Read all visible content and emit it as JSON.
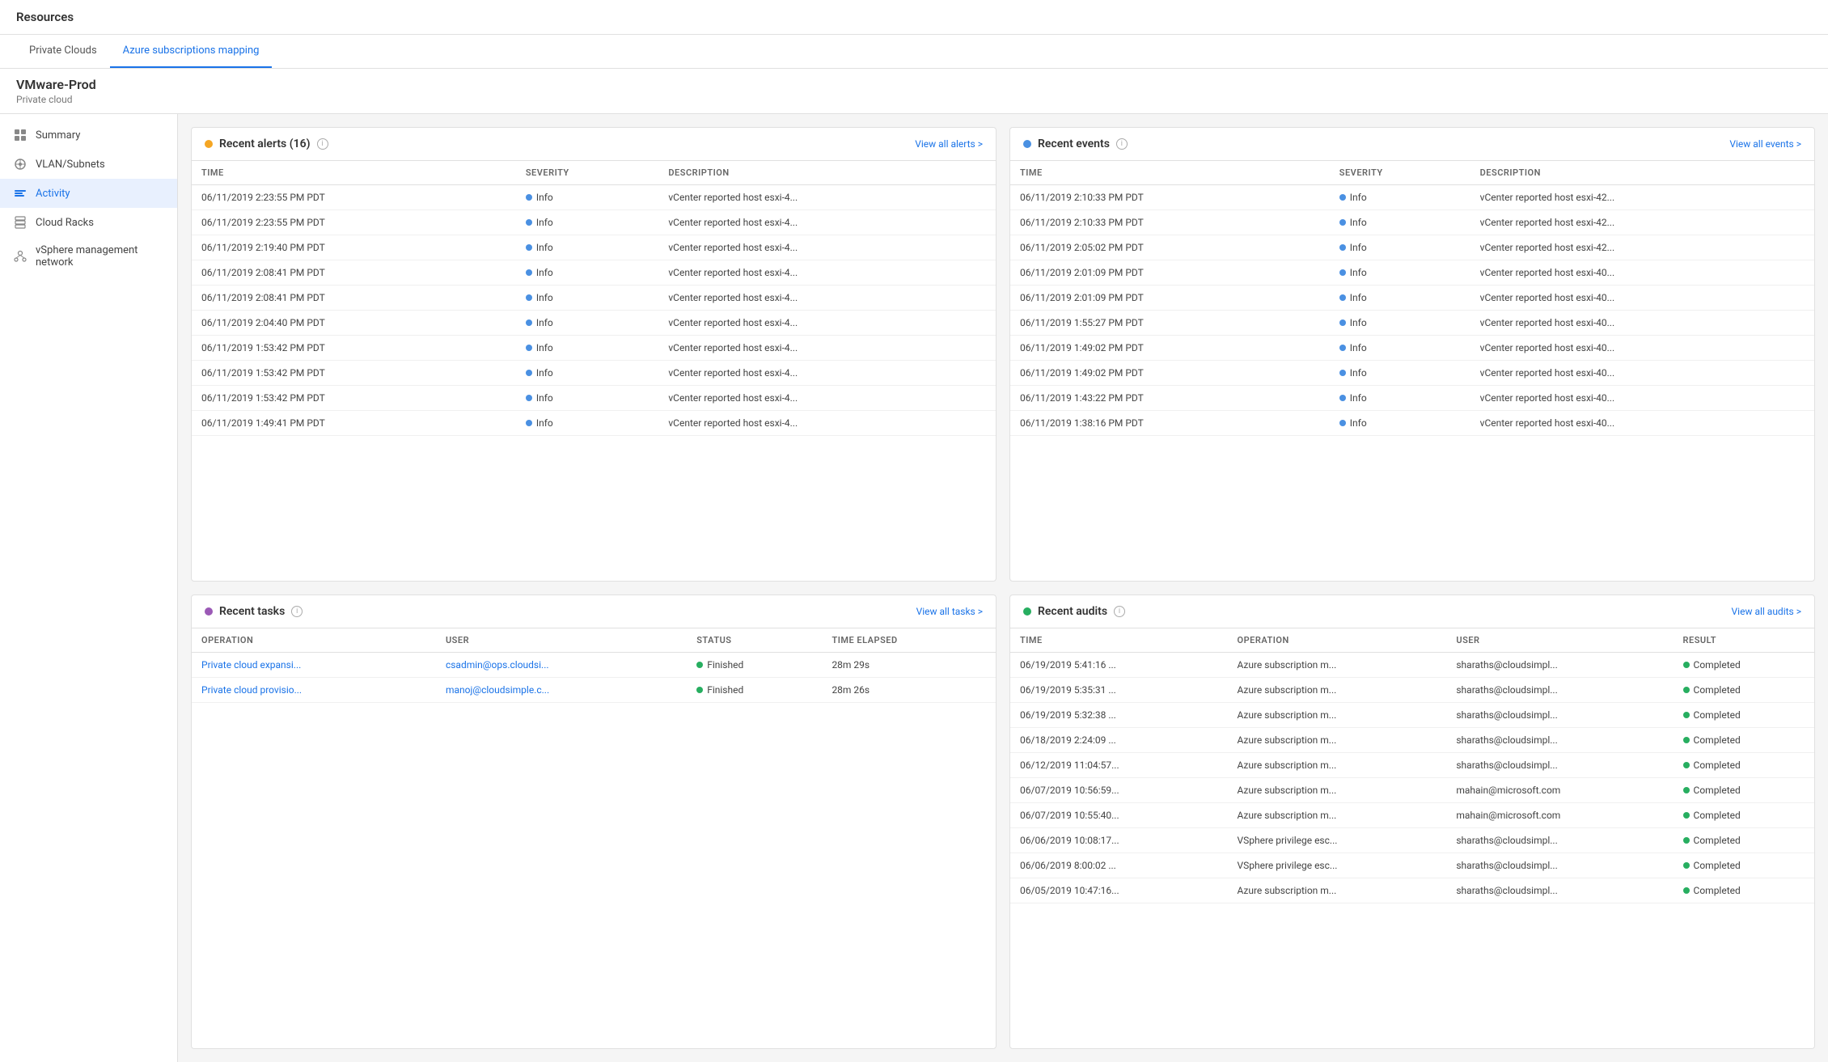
{
  "topBar": {
    "title": "Resources"
  },
  "tabs": [
    {
      "label": "Private Clouds",
      "active": false
    },
    {
      "label": "Azure subscriptions mapping",
      "active": false
    }
  ],
  "vmHeader": {
    "name": "VMware-Prod",
    "subtitle": "Private cloud"
  },
  "sidebar": {
    "items": [
      {
        "label": "Summary",
        "icon": "grid",
        "active": false
      },
      {
        "label": "VLAN/Subnets",
        "icon": "subnet",
        "active": false
      },
      {
        "label": "Activity",
        "icon": "activity",
        "active": true
      },
      {
        "label": "Cloud Racks",
        "icon": "rack",
        "active": false
      },
      {
        "label": "vSphere management network",
        "icon": "network",
        "active": false
      }
    ]
  },
  "alerts": {
    "title": "Recent alerts",
    "count": "16",
    "viewAllLabel": "View all alerts >",
    "columns": [
      "TIME",
      "SEVERITY",
      "DESCRIPTION"
    ],
    "rows": [
      {
        "time": "06/11/2019 2:23:55 PM PDT",
        "severity": "Info",
        "description": "vCenter reported host esxi-4..."
      },
      {
        "time": "06/11/2019 2:23:55 PM PDT",
        "severity": "Info",
        "description": "vCenter reported host esxi-4..."
      },
      {
        "time": "06/11/2019 2:19:40 PM PDT",
        "severity": "Info",
        "description": "vCenter reported host esxi-4..."
      },
      {
        "time": "06/11/2019 2:08:41 PM PDT",
        "severity": "Info",
        "description": "vCenter reported host esxi-4..."
      },
      {
        "time": "06/11/2019 2:08:41 PM PDT",
        "severity": "Info",
        "description": "vCenter reported host esxi-4..."
      },
      {
        "time": "06/11/2019 2:04:40 PM PDT",
        "severity": "Info",
        "description": "vCenter reported host esxi-4..."
      },
      {
        "time": "06/11/2019 1:53:42 PM PDT",
        "severity": "Info",
        "description": "vCenter reported host esxi-4..."
      },
      {
        "time": "06/11/2019 1:53:42 PM PDT",
        "severity": "Info",
        "description": "vCenter reported host esxi-4..."
      },
      {
        "time": "06/11/2019 1:53:42 PM PDT",
        "severity": "Info",
        "description": "vCenter reported host esxi-4..."
      },
      {
        "time": "06/11/2019 1:49:41 PM PDT",
        "severity": "Info",
        "description": "vCenter reported host esxi-4..."
      }
    ]
  },
  "events": {
    "title": "Recent events",
    "viewAllLabel": "View all events >",
    "columns": [
      "TIME",
      "SEVERITY",
      "DESCRIPTION"
    ],
    "rows": [
      {
        "time": "06/11/2019 2:10:33 PM PDT",
        "severity": "Info",
        "description": "vCenter reported host esxi-42..."
      },
      {
        "time": "06/11/2019 2:10:33 PM PDT",
        "severity": "Info",
        "description": "vCenter reported host esxi-42..."
      },
      {
        "time": "06/11/2019 2:05:02 PM PDT",
        "severity": "Info",
        "description": "vCenter reported host esxi-42..."
      },
      {
        "time": "06/11/2019 2:01:09 PM PDT",
        "severity": "Info",
        "description": "vCenter reported host esxi-40..."
      },
      {
        "time": "06/11/2019 2:01:09 PM PDT",
        "severity": "Info",
        "description": "vCenter reported host esxi-40..."
      },
      {
        "time": "06/11/2019 1:55:27 PM PDT",
        "severity": "Info",
        "description": "vCenter reported host esxi-40..."
      },
      {
        "time": "06/11/2019 1:49:02 PM PDT",
        "severity": "Info",
        "description": "vCenter reported host esxi-40..."
      },
      {
        "time": "06/11/2019 1:49:02 PM PDT",
        "severity": "Info",
        "description": "vCenter reported host esxi-40..."
      },
      {
        "time": "06/11/2019 1:43:22 PM PDT",
        "severity": "Info",
        "description": "vCenter reported host esxi-40..."
      },
      {
        "time": "06/11/2019 1:38:16 PM PDT",
        "severity": "Info",
        "description": "vCenter reported host esxi-40..."
      }
    ]
  },
  "tasks": {
    "title": "Recent tasks",
    "viewAllLabel": "View all tasks >",
    "columns": [
      "OPERATION",
      "USER",
      "STATUS",
      "TIME ELAPSED"
    ],
    "rows": [
      {
        "operation": "Private cloud expansi...",
        "user": "csadmin@ops.cloudsi...",
        "status": "Finished",
        "timeElapsed": "28m 29s"
      },
      {
        "operation": "Private cloud provisio...",
        "user": "manoj@cloudsimple.c...",
        "status": "Finished",
        "timeElapsed": "28m 26s"
      }
    ]
  },
  "audits": {
    "title": "Recent audits",
    "viewAllLabel": "View all audits >",
    "columns": [
      "TIME",
      "OPERATION",
      "USER",
      "RESULT"
    ],
    "rows": [
      {
        "time": "06/19/2019 5:41:16 ...",
        "operation": "Azure subscription m...",
        "user": "sharaths@cloudsimpl...",
        "result": "Completed"
      },
      {
        "time": "06/19/2019 5:35:31 ...",
        "operation": "Azure subscription m...",
        "user": "sharaths@cloudsimpl...",
        "result": "Completed"
      },
      {
        "time": "06/19/2019 5:32:38 ...",
        "operation": "Azure subscription m...",
        "user": "sharaths@cloudsimpl...",
        "result": "Completed"
      },
      {
        "time": "06/18/2019 2:24:09 ...",
        "operation": "Azure subscription m...",
        "user": "sharaths@cloudsimpl...",
        "result": "Completed"
      },
      {
        "time": "06/12/2019 11:04:57...",
        "operation": "Azure subscription m...",
        "user": "sharaths@cloudsimpl...",
        "result": "Completed"
      },
      {
        "time": "06/07/2019 10:56:59...",
        "operation": "Azure subscription m...",
        "user": "mahain@microsoft.com",
        "result": "Completed"
      },
      {
        "time": "06/07/2019 10:55:40...",
        "operation": "Azure subscription m...",
        "user": "mahain@microsoft.com",
        "result": "Completed"
      },
      {
        "time": "06/06/2019 10:08:17...",
        "operation": "VSphere privilege esc...",
        "user": "sharaths@cloudsimpl...",
        "result": "Completed"
      },
      {
        "time": "06/06/2019 8:00:02 ...",
        "operation": "VSphere privilege esc...",
        "user": "sharaths@cloudsimpl...",
        "result": "Completed"
      },
      {
        "time": "06/05/2019 10:47:16...",
        "operation": "Azure subscription m...",
        "user": "sharaths@cloudsimpl...",
        "result": "Completed"
      }
    ]
  }
}
